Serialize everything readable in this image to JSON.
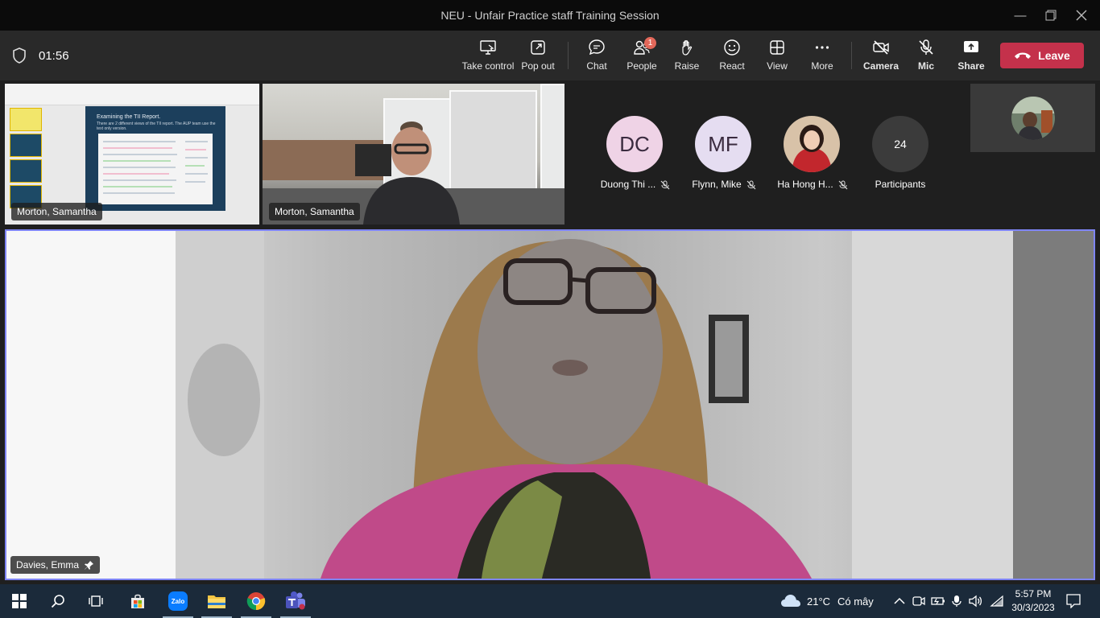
{
  "window": {
    "title": "NEU - Unfair Practice staff Training Session"
  },
  "meeting": {
    "timer": "01:56"
  },
  "toolbar": {
    "take_control": "Take control",
    "pop_out": "Pop out",
    "chat": "Chat",
    "people": "People",
    "people_badge": "1",
    "raise": "Raise",
    "react": "React",
    "view": "View",
    "more": "More",
    "camera": "Camera",
    "mic": "Mic",
    "share": "Share",
    "leave": "Leave"
  },
  "tiles": {
    "screen_share_name": "Morton, Samantha",
    "camera_name": "Morton, Samantha",
    "slide_title": "Examining the TII Report.",
    "slide_text": "There are 2 different views of the TII report. The AUP team use the text only version."
  },
  "participants": [
    {
      "initials": "DC",
      "name": "Duong Thi ...",
      "color": "#efd3e6"
    },
    {
      "initials": "MF",
      "name": "Flynn, Mike",
      "color": "#e5ddf1"
    },
    {
      "initials": "",
      "name": "Ha Hong H...",
      "color": "#c2272d"
    }
  ],
  "overflow": {
    "count": "24",
    "label": "Participants"
  },
  "main_speaker": {
    "name": "Davies, Emma"
  },
  "taskbar": {
    "weather_temp": "21°C",
    "weather_desc": "Có mây",
    "time": "5:57 PM",
    "date": "30/3/2023",
    "zalo_label": "Zalo"
  },
  "colors": {
    "leave": "#c4314b",
    "active_speaker_border": "#7f85f5",
    "badge": "#e3685a"
  }
}
